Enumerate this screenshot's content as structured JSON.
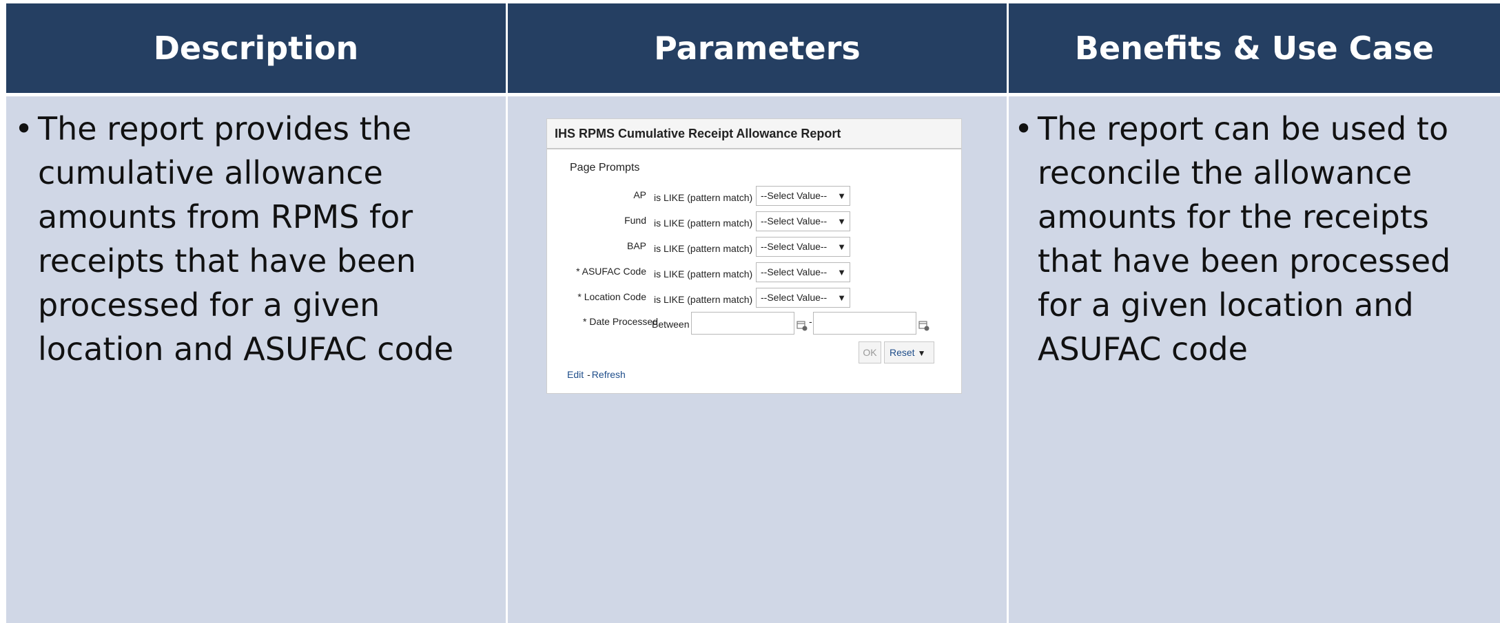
{
  "table": {
    "headers": [
      "Description",
      "Parameters",
      "Benefits & Use Case"
    ]
  },
  "description": {
    "bullet": "•",
    "text": "The report provides the cumulative allowance amounts from RPMS for receipts that have been processed for a  given location and ASUFAC code"
  },
  "benefits": {
    "bullet": "•",
    "text": "The report can be used to reconcile the allowance amounts for the receipts that have been processed for a given location and ASUFAC code"
  },
  "parameters_panel": {
    "title": "IHS RPMS Cumulative Receipt Allowance Report",
    "section_title": "Page Prompts",
    "prompts": [
      {
        "label": "AP",
        "operator": "is LIKE (pattern match)",
        "value": "--Select Value--"
      },
      {
        "label": "Fund",
        "operator": "is LIKE (pattern match)",
        "value": "--Select Value--"
      },
      {
        "label": "BAP",
        "operator": "is LIKE (pattern match)",
        "value": "--Select Value--"
      },
      {
        "label": "* ASUFAC Code",
        "operator": "is LIKE (pattern match)",
        "value": "--Select Value--"
      },
      {
        "label": "* Location Code",
        "operator": "is LIKE (pattern match)",
        "value": "--Select Value--"
      }
    ],
    "date_prompt": {
      "label": "* Date Processed",
      "operator": "Between",
      "separator": "-"
    },
    "ok_label": "OK",
    "reset_label": "Reset",
    "edit_label": "Edit",
    "refresh_label": "Refresh",
    "link_separator": "-",
    "dropdown_icon": "triangle-down-icon",
    "calendar_icon": "calendar-icon"
  },
  "colors": {
    "header_bg": "#253f62",
    "body_bg": "#d0d7e6",
    "link": "#1e4d8a"
  }
}
